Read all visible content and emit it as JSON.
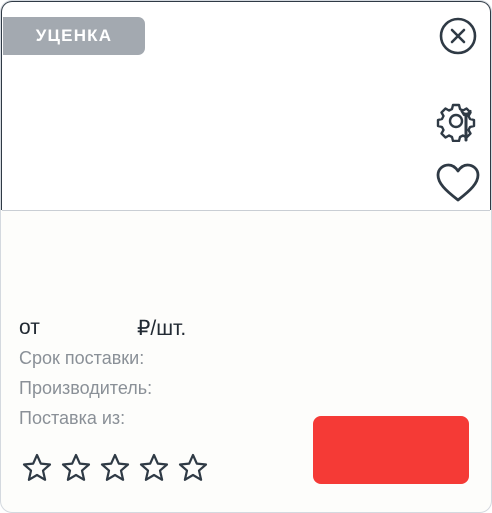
{
  "badge": {
    "label": "УЦЕНКА"
  },
  "icons": {
    "close": "close-circle-icon",
    "tools": "gear-wrench-icon",
    "favorite": "heart-icon"
  },
  "price": {
    "prefix": "от",
    "unit": "₽/шт."
  },
  "details": {
    "delivery_time_label": "Срок поставки:",
    "manufacturer_label": "Производитель:",
    "shipped_from_label": "Поставка из:"
  },
  "rating": {
    "stars_total": 5,
    "stars_filled": 0
  },
  "colors": {
    "badge_bg": "#a3a9b0",
    "action_button": "#f53a36",
    "icon_stroke": "#2f3a45"
  }
}
